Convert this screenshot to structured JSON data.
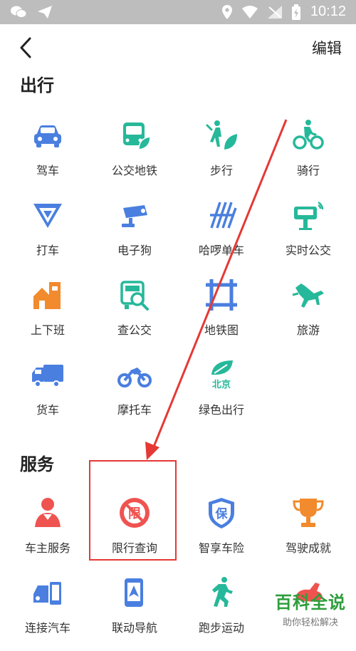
{
  "status_bar": {
    "time": "10:12"
  },
  "header": {
    "edit_label": "编辑"
  },
  "sections": {
    "travel": {
      "title": "出行",
      "items": [
        {
          "label": "驾车",
          "icon": "car-icon"
        },
        {
          "label": "公交地铁",
          "icon": "bus-icon"
        },
        {
          "label": "步行",
          "icon": "walk-icon"
        },
        {
          "label": "骑行",
          "icon": "bike-icon"
        },
        {
          "label": "打车",
          "icon": "taxi-icon"
        },
        {
          "label": "电子狗",
          "icon": "camera-icon"
        },
        {
          "label": "哈啰单车",
          "icon": "hello-bike-icon"
        },
        {
          "label": "实时公交",
          "icon": "bus-stop-icon"
        },
        {
          "label": "上下班",
          "icon": "commute-icon"
        },
        {
          "label": "查公交",
          "icon": "bus-search-icon"
        },
        {
          "label": "地铁图",
          "icon": "subway-map-icon"
        },
        {
          "label": "旅游",
          "icon": "horse-icon"
        },
        {
          "label": "货车",
          "icon": "truck-icon"
        },
        {
          "label": "摩托车",
          "icon": "motorcycle-icon"
        },
        {
          "label": "绿色出行",
          "icon": "leaf-icon",
          "badge": "北京"
        }
      ]
    },
    "service": {
      "title": "服务",
      "items": [
        {
          "label": "车主服务",
          "icon": "owner-icon"
        },
        {
          "label": "限行查询",
          "icon": "restriction-icon",
          "badge": "限"
        },
        {
          "label": "智享车险",
          "icon": "insurance-shield-icon",
          "badge": "保"
        },
        {
          "label": "驾驶成就",
          "icon": "trophy-icon"
        },
        {
          "label": "连接汽车",
          "icon": "car-phone-icon"
        },
        {
          "label": "联动导航",
          "icon": "phone-nav-icon"
        },
        {
          "label": "跑步运动",
          "icon": "run-icon"
        },
        {
          "label": "",
          "icon": "rabbit-icon"
        }
      ]
    }
  },
  "watermark": {
    "title": "百科全说",
    "subtitle": "助你轻松解决"
  },
  "colors": {
    "blue": "#4a7fe0",
    "green": "#26b89a",
    "orange": "#f28a2e",
    "red": "#e53935",
    "status_gray": "#bdbdbd"
  }
}
